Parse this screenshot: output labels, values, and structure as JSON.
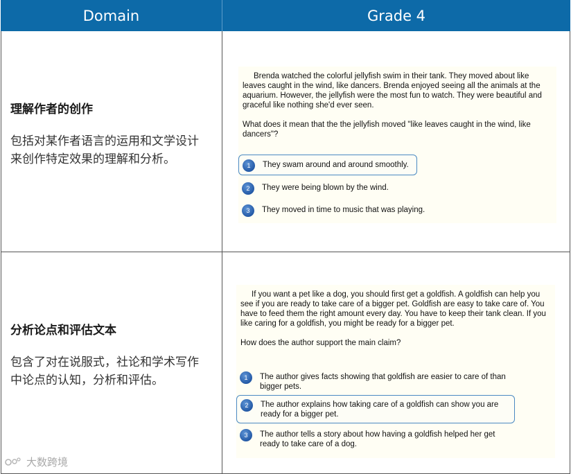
{
  "header": {
    "domain_label": "Domain",
    "grade_label": "Grade 4"
  },
  "colors": {
    "header_bg": "#0d6aa8",
    "panel_bg": "#fffef4",
    "selected_border": "#4a89c2",
    "bubble": "#2359a6"
  },
  "rows": [
    {
      "domain_title": "理解作者的创作",
      "domain_desc": "包括对某作者语言的运用和文学设计来创作特定效果的理解和分析。",
      "passage": "Brenda watched the colorful jellyfish swim in their tank. They moved about like leaves caught in the wind, like dancers. Brenda enjoyed seeing all the animals at the aquarium. However, the jellyfish were the most fun to watch. They were beautiful and graceful like nothing she'd ever seen.",
      "question": "What does it mean that the the jellyfish moved \"like leaves caught in the wind, like dancers\"?",
      "choices": [
        {
          "number": "1",
          "text": "They swam around and around smoothly.",
          "selected": true
        },
        {
          "number": "2",
          "text": "They were being blown by the wind.",
          "selected": false
        },
        {
          "number": "3",
          "text": "They moved in time to music that was playing.",
          "selected": false
        }
      ]
    },
    {
      "domain_title": "分析论点和评估文本",
      "domain_desc": "包含了对在说服式，社论和学术写作中论点的认知，分析和评估。",
      "passage": "If you want a pet like a dog, you should first get a goldfish. A goldfish can help you see if you are ready to take care of a bigger pet. Goldfish are easy to take care of. You have to feed them the right amount every day. You have to keep their tank clean. If you like caring for a goldfish, you might be ready for a bigger pet.",
      "question": "How does the author support the main claim?",
      "choices": [
        {
          "number": "1",
          "text": "The author gives facts showing that goldfish are easier to care of than bigger pets.",
          "selected": false
        },
        {
          "number": "2",
          "text": "The author explains how taking care of a goldfish can show you are ready for a bigger pet.",
          "selected": true
        },
        {
          "number": "3",
          "text": "The author tells a story about how having a goldfish helped her get ready to take care of a dog.",
          "selected": false
        }
      ]
    }
  ],
  "watermark": {
    "text": "大数跨境",
    "icon": "watermark-logo-icon"
  }
}
